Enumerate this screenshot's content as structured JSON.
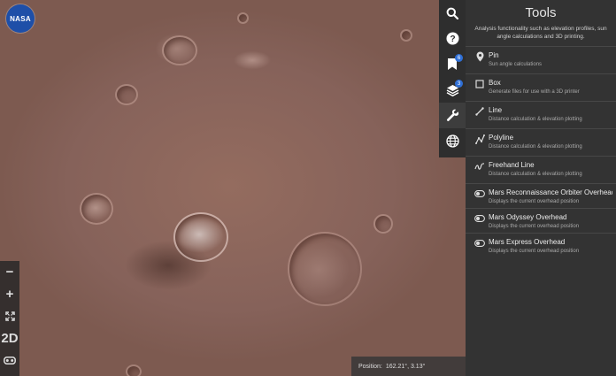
{
  "app": {
    "logo_text": "NASA"
  },
  "map": {
    "position_label": "Position:",
    "position_value": "162.21°, 3.13°"
  },
  "zoom": {
    "zoom_out": "−",
    "zoom_in": "+",
    "fullscreen": "⛶",
    "mode_2d": "2D",
    "vr": "VR"
  },
  "toolbar": {
    "items": [
      {
        "name": "search",
        "icon": "search-icon"
      },
      {
        "name": "help",
        "icon": "help-icon"
      },
      {
        "name": "bookmarks",
        "icon": "bookmark-icon",
        "badge": "6"
      },
      {
        "name": "layers",
        "icon": "layers-icon",
        "badge": "3"
      },
      {
        "name": "tools",
        "icon": "wrench-icon",
        "active": true
      },
      {
        "name": "globe",
        "icon": "globe-icon"
      }
    ],
    "accent": "#2f6fd6"
  },
  "tools_panel": {
    "title": "Tools",
    "description_line1": "Analysis functionality such as elevation profiles, sun",
    "description_line2": "angle calculations and 3D printing.",
    "tools": [
      {
        "name": "Pin",
        "desc": "Sun angle calculations",
        "icon": "pin-icon"
      },
      {
        "name": "Box",
        "desc": "Generate files for use with a 3D printer",
        "icon": "box-icon"
      },
      {
        "name": "Line",
        "desc": "Distance calculation & elevation plotting",
        "icon": "line-icon"
      },
      {
        "name": "Polyline",
        "desc": "Distance calculation & elevation plotting",
        "icon": "polyline-icon"
      },
      {
        "name": "Freehand Line",
        "desc": "Distance calculation & elevation plotting",
        "icon": "freehand-icon"
      },
      {
        "name": "Mars Reconnaissance Orbiter Overhead",
        "desc": "Displays the current overhead position",
        "icon": "toggle-icon"
      },
      {
        "name": "Mars Odyssey Overhead",
        "desc": "Displays the current overhead position",
        "icon": "toggle-icon"
      },
      {
        "name": "Mars Express Overhead",
        "desc": "Displays the current overhead position",
        "icon": "toggle-icon"
      }
    ]
  }
}
